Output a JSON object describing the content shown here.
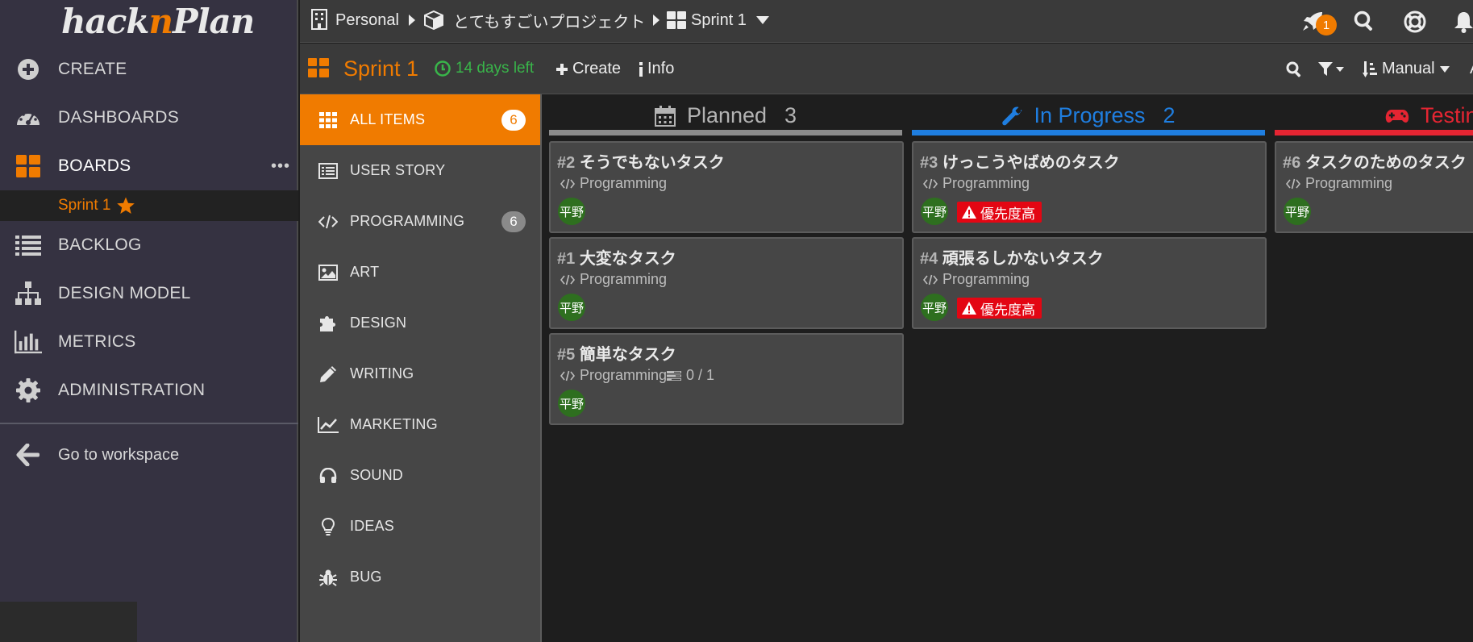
{
  "app": {
    "logo_main": "hack",
    "logo_accent": "n",
    "logo_tail": "Plan"
  },
  "nav": {
    "create": "CREATE",
    "dashboards": "DASHBOARDS",
    "boards": "BOARDS",
    "boards_more": "•••",
    "sprint_sub": "Sprint 1",
    "backlog": "BACKLOG",
    "design_model": "DESIGN MODEL",
    "metrics": "METRICS",
    "administration": "ADMINISTRATION",
    "go_to_workspace": "Go to workspace"
  },
  "breadcrumb": {
    "workspace": "Personal",
    "project": "とてもすごいプロジェクト",
    "board": "Sprint 1"
  },
  "top": {
    "notifications_count": "1"
  },
  "sprintbar": {
    "title": "Sprint 1",
    "days_left": "14 days left",
    "create": "Create",
    "info": "Info",
    "sort": "Manual",
    "truncated": "A"
  },
  "categories": [
    {
      "label": "ALL ITEMS",
      "count": "6",
      "icon": "grid-icon"
    },
    {
      "label": "USER STORY",
      "count": "",
      "icon": "list-card-icon"
    },
    {
      "label": "PROGRAMMING",
      "count": "6",
      "icon": "code-icon"
    },
    {
      "label": "ART",
      "count": "",
      "icon": "image-icon"
    },
    {
      "label": "DESIGN",
      "count": "",
      "icon": "puzzle-icon"
    },
    {
      "label": "WRITING",
      "count": "",
      "icon": "pencil-icon"
    },
    {
      "label": "MARKETING",
      "count": "",
      "icon": "chart-line-icon"
    },
    {
      "label": "SOUND",
      "count": "",
      "icon": "headphones-icon"
    },
    {
      "label": "IDEAS",
      "count": "",
      "icon": "lightbulb-icon"
    },
    {
      "label": "BUG",
      "count": "",
      "icon": "bug-icon"
    }
  ],
  "columns": [
    {
      "title": "Planned",
      "count": "3",
      "color": "#8c8c8c",
      "icon": "calendar-icon"
    },
    {
      "title": "In Progress",
      "count": "2",
      "color": "#1f7ee0",
      "icon": "wrench-icon"
    },
    {
      "title": "Testing",
      "count": "",
      "color": "#e52532",
      "icon": "gamepad-icon"
    }
  ],
  "cards": [
    {
      "num": "#2",
      "title": "そうでもないタスク",
      "category": "Programming",
      "assignee": "平野",
      "priority": "",
      "subtasks": ""
    },
    {
      "num": "#1",
      "title": "大変なタスク",
      "category": "Programming",
      "assignee": "平野",
      "priority": "",
      "subtasks": ""
    },
    {
      "num": "#5",
      "title": "簡単なタスク",
      "category": "Programming",
      "assignee": "平野",
      "priority": "",
      "subtasks": "0 / 1"
    },
    {
      "num": "#3",
      "title": "けっこうやばめのタスク",
      "category": "Programming",
      "assignee": "平野",
      "priority": "優先度高",
      "subtasks": ""
    },
    {
      "num": "#4",
      "title": "頑張るしかないタスク",
      "category": "Programming",
      "assignee": "平野",
      "priority": "優先度高",
      "subtasks": ""
    },
    {
      "num": "#6",
      "title": "タスクのためのタスク",
      "category": "Programming",
      "assignee": "平野",
      "priority": "",
      "subtasks": ""
    }
  ],
  "colors": {
    "accent": "#f07b00",
    "priority_high": "#e30613",
    "days_left": "#39b54a"
  }
}
